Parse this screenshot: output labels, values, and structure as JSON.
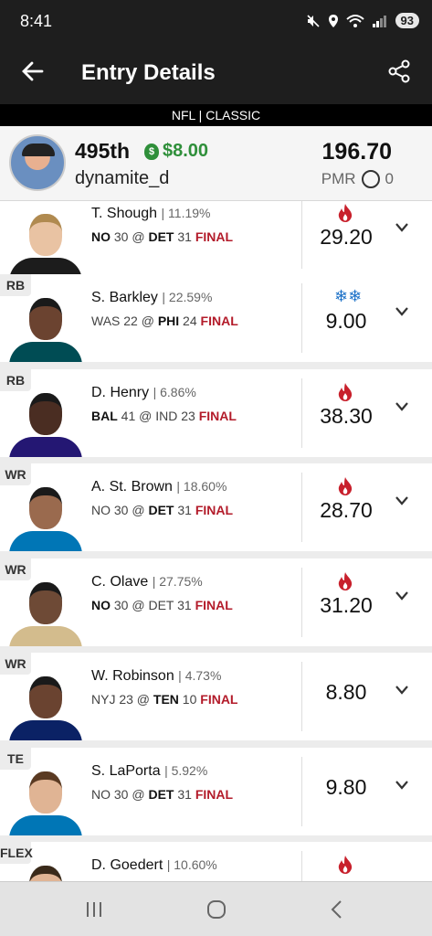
{
  "status_bar": {
    "time": "8:41",
    "battery": "93",
    "signal_label": "5"
  },
  "app_bar": {
    "title": "Entry Details"
  },
  "subheader": {
    "text": "NFL | CLASSIC"
  },
  "entry": {
    "rank": "495th",
    "winnings": "$8.00",
    "username": "dynamite_d",
    "score": "196.70",
    "pmr_label": "PMR",
    "pmr_value": "0"
  },
  "players": [
    {
      "position": "",
      "name": "T. Shough",
      "owned": "11.19%",
      "game": [
        [
          "NO",
          true
        ],
        [
          " 30 @ ",
          false
        ],
        [
          "DET",
          true
        ],
        [
          " 31 ",
          false
        ]
      ],
      "final": "FINAL",
      "points": "29.20",
      "trend": "hot",
      "skin": "#e9c3a3",
      "jersey": "#1c1c1c",
      "hair": "#b08a50"
    },
    {
      "position": "RB",
      "name": "S. Barkley",
      "owned": "22.59%",
      "game": [
        [
          "WAS",
          false
        ],
        [
          " 22 @ ",
          false
        ],
        [
          "PHI",
          true
        ],
        [
          " 24 ",
          false
        ]
      ],
      "final": "FINAL",
      "points": "9.00",
      "trend": "cold",
      "skin": "#6b4330",
      "jersey": "#004c54",
      "hair": "#1a1a1a"
    },
    {
      "position": "RB",
      "name": "D. Henry",
      "owned": "6.86%",
      "game": [
        [
          "BAL",
          true
        ],
        [
          " 41 @ ",
          false
        ],
        [
          "IND",
          false
        ],
        [
          " 23 ",
          false
        ]
      ],
      "final": "FINAL",
      "points": "38.30",
      "trend": "hot",
      "skin": "#4a2d22",
      "jersey": "#241773",
      "hair": "#1a1a1a"
    },
    {
      "position": "WR",
      "name": "A. St. Brown",
      "owned": "18.60%",
      "game": [
        [
          "NO",
          false
        ],
        [
          " 30 @ ",
          false
        ],
        [
          "DET",
          true
        ],
        [
          " 31 ",
          false
        ]
      ],
      "final": "FINAL",
      "points": "28.70",
      "trend": "hot",
      "skin": "#9a6a4e",
      "jersey": "#0076b6",
      "hair": "#1a1a1a"
    },
    {
      "position": "WR",
      "name": "C. Olave",
      "owned": "27.75%",
      "game": [
        [
          "NO",
          true
        ],
        [
          " 30 @ ",
          false
        ],
        [
          "DET",
          false
        ],
        [
          " 31 ",
          false
        ]
      ],
      "final": "FINAL",
      "points": "31.20",
      "trend": "hot",
      "skin": "#6e4a36",
      "jersey": "#d3bc8d",
      "hair": "#1a1a1a"
    },
    {
      "position": "WR",
      "name": "W. Robinson",
      "owned": "4.73%",
      "game": [
        [
          "NYJ",
          false
        ],
        [
          " 23 @ ",
          false
        ],
        [
          "TEN",
          true
        ],
        [
          " 10 ",
          false
        ]
      ],
      "final": "FINAL",
      "points": "8.80",
      "trend": "none",
      "skin": "#6a4330",
      "jersey": "#0b2265",
      "hair": "#1a1a1a"
    },
    {
      "position": "TE",
      "name": "S. LaPorta",
      "owned": "5.92%",
      "game": [
        [
          "NO",
          false
        ],
        [
          " 30 @ ",
          false
        ],
        [
          "DET",
          true
        ],
        [
          " 31 ",
          false
        ]
      ],
      "final": "FINAL",
      "points": "9.80",
      "trend": "none",
      "skin": "#e0b494",
      "jersey": "#0076b6",
      "hair": "#5a3a22"
    },
    {
      "position": "FLEX",
      "name": "D. Goedert",
      "owned": "10.60%",
      "game": [],
      "final": "",
      "points": "",
      "trend": "hot",
      "skin": "#e0b494",
      "jersey": "#004c54",
      "hair": "#3a2a1a"
    }
  ]
}
